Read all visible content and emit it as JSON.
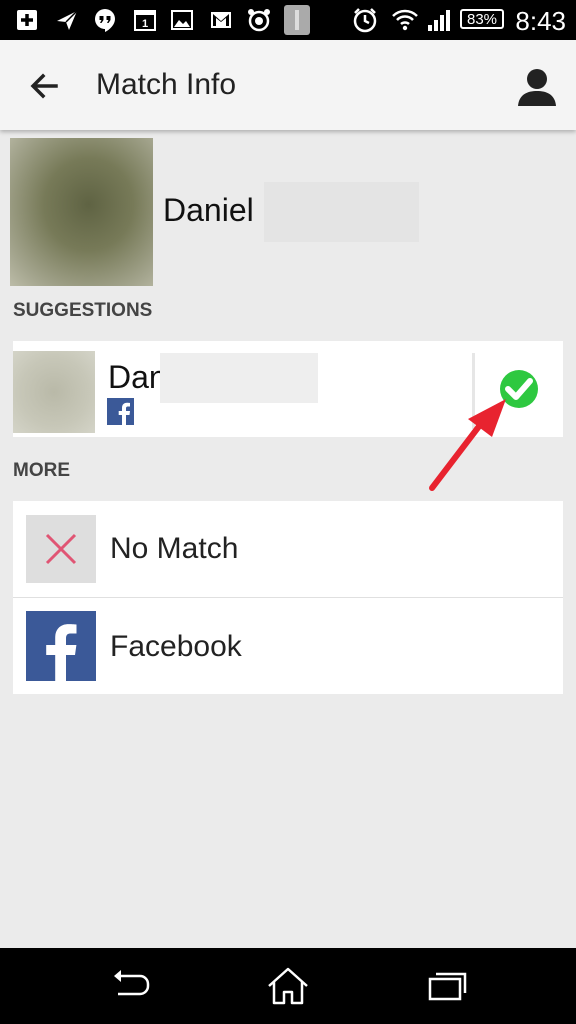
{
  "status_bar": {
    "time": "8:43",
    "battery": "83%",
    "icons": [
      "add-icon",
      "paper-plane-icon",
      "hangouts-icon",
      "calendar-icon",
      "gallery-icon",
      "gmail-icon",
      "alarm-app-icon",
      "notification-icon",
      "alarm-clock-icon",
      "wifi-icon",
      "signal-icon",
      "battery-icon"
    ],
    "calendar_day": "1"
  },
  "app_bar": {
    "title": "Match Info",
    "back_icon": "arrow-back-icon",
    "account_icon": "person-icon"
  },
  "match": {
    "name": "Daniel"
  },
  "suggestions": {
    "header": "SUGGESTIONS",
    "items": [
      {
        "name": "Dan",
        "source_icon": "facebook-icon",
        "action_icon": "check-circle-icon"
      }
    ]
  },
  "more": {
    "header": "MORE",
    "items": [
      {
        "label": "No Match",
        "icon": "close-icon"
      },
      {
        "label": "Facebook",
        "icon": "facebook-icon"
      }
    ]
  },
  "colors": {
    "facebook": "#3b5998",
    "check_green": "#2ec840",
    "close_pink": "#e05574",
    "annotation_arrow": "#e8232f"
  },
  "nav_bar": {
    "icons": [
      "back-nav-icon",
      "home-icon",
      "recents-icon"
    ]
  }
}
